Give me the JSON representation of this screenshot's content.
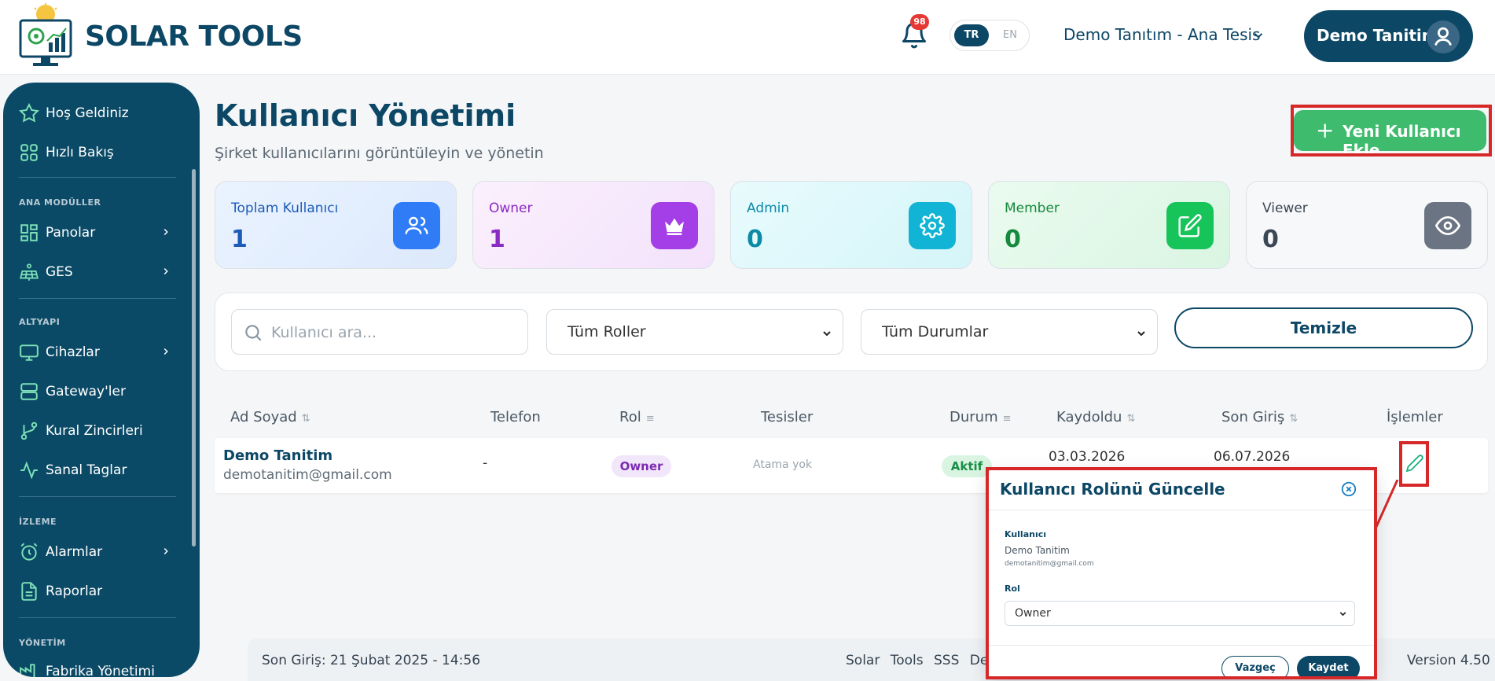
{
  "header": {
    "brand": "SOLAR TOOLS",
    "notification_count": "98",
    "lang_tr": "TR",
    "lang_en": "EN",
    "facility": "Demo Tanıtım - Ana Tesis",
    "user_name": "Demo Tanitim"
  },
  "sidebar": {
    "top_items": [
      {
        "label": "Hoş Geldiniz",
        "icon": "star-icon"
      },
      {
        "label": "Hızlı Bakış",
        "icon": "grid-icon"
      }
    ],
    "sections": [
      {
        "title": "ANA MODÜLLER",
        "items": [
          {
            "label": "Panolar",
            "icon": "dashboard-icon",
            "has_submenu": true
          },
          {
            "label": "GES",
            "icon": "solar-panel-icon",
            "has_submenu": true
          }
        ]
      },
      {
        "title": "ALTYAPI",
        "items": [
          {
            "label": "Cihazlar",
            "icon": "monitor-icon",
            "has_submenu": true
          },
          {
            "label": "Gateway'ler",
            "icon": "server-icon",
            "has_submenu": false
          },
          {
            "label": "Kural Zincirleri",
            "icon": "git-branch-icon",
            "has_submenu": false
          },
          {
            "label": "Sanal Taglar",
            "icon": "activity-icon",
            "has_submenu": false
          }
        ]
      },
      {
        "title": "İZLEME",
        "items": [
          {
            "label": "Alarmlar",
            "icon": "alarm-clock-icon",
            "has_submenu": true
          },
          {
            "label": "Raporlar",
            "icon": "document-icon",
            "has_submenu": false
          }
        ]
      },
      {
        "title": "YÖNETİM",
        "items": [
          {
            "label": "Fabrika Yönetimi",
            "icon": "factory-icon",
            "has_submenu": false
          }
        ]
      }
    ]
  },
  "main": {
    "title": "Kullanıcı Yönetimi",
    "subtitle": "Şirket kullanıcılarını görüntüleyin ve yönetin",
    "add_button": "Yeni Kullanıcı Ekle"
  },
  "stats": [
    {
      "label": "Toplam Kullanıcı",
      "value": "1",
      "icon": "users-icon",
      "color": "#2f7cf6"
    },
    {
      "label": "Owner",
      "value": "1",
      "icon": "crown-icon",
      "color": "#a43ee6"
    },
    {
      "label": "Admin",
      "value": "0",
      "icon": "gear-icon",
      "color": "#11b4d4"
    },
    {
      "label": "Member",
      "value": "0",
      "icon": "edit-icon",
      "color": "#16c45a"
    },
    {
      "label": "Viewer",
      "value": "0",
      "icon": "eye-icon",
      "color": "#6b7482"
    }
  ],
  "filters": {
    "search_placeholder": "Kullanıcı ara...",
    "role_select": "Tüm Roller",
    "status_select": "Tüm Durumlar",
    "clear_button": "Temizle"
  },
  "table": {
    "headers": {
      "name": "Ad Soyad",
      "phone": "Telefon",
      "role": "Rol",
      "facilities": "Tesisler",
      "status": "Durum",
      "registered": "Kaydoldu",
      "last_login": "Son Giriş",
      "actions": "İşlemler"
    },
    "rows": [
      {
        "name": "Demo Tanitim",
        "email": "demotanitim@gmail.com",
        "phone": "-",
        "role": "Owner",
        "facilities": "Atama yok",
        "status": "Aktif",
        "registered": "03.03.2026",
        "last_login": "06.07.2026"
      }
    ]
  },
  "modal": {
    "title": "Kullanıcı Rolünü Güncelle",
    "user_label": "Kullanıcı",
    "user_name": "Demo Tanitim",
    "user_email": "demotanitim@gmail.com",
    "role_label": "Rol",
    "role_value": "Owner",
    "cancel": "Vazgeç",
    "save": "Kaydet"
  },
  "footer": {
    "last_login": "Son Giriş: 21 Şubat 2025 - 14:56",
    "links": "Solar Tools SSS De",
    "version": "Version 4.50"
  }
}
